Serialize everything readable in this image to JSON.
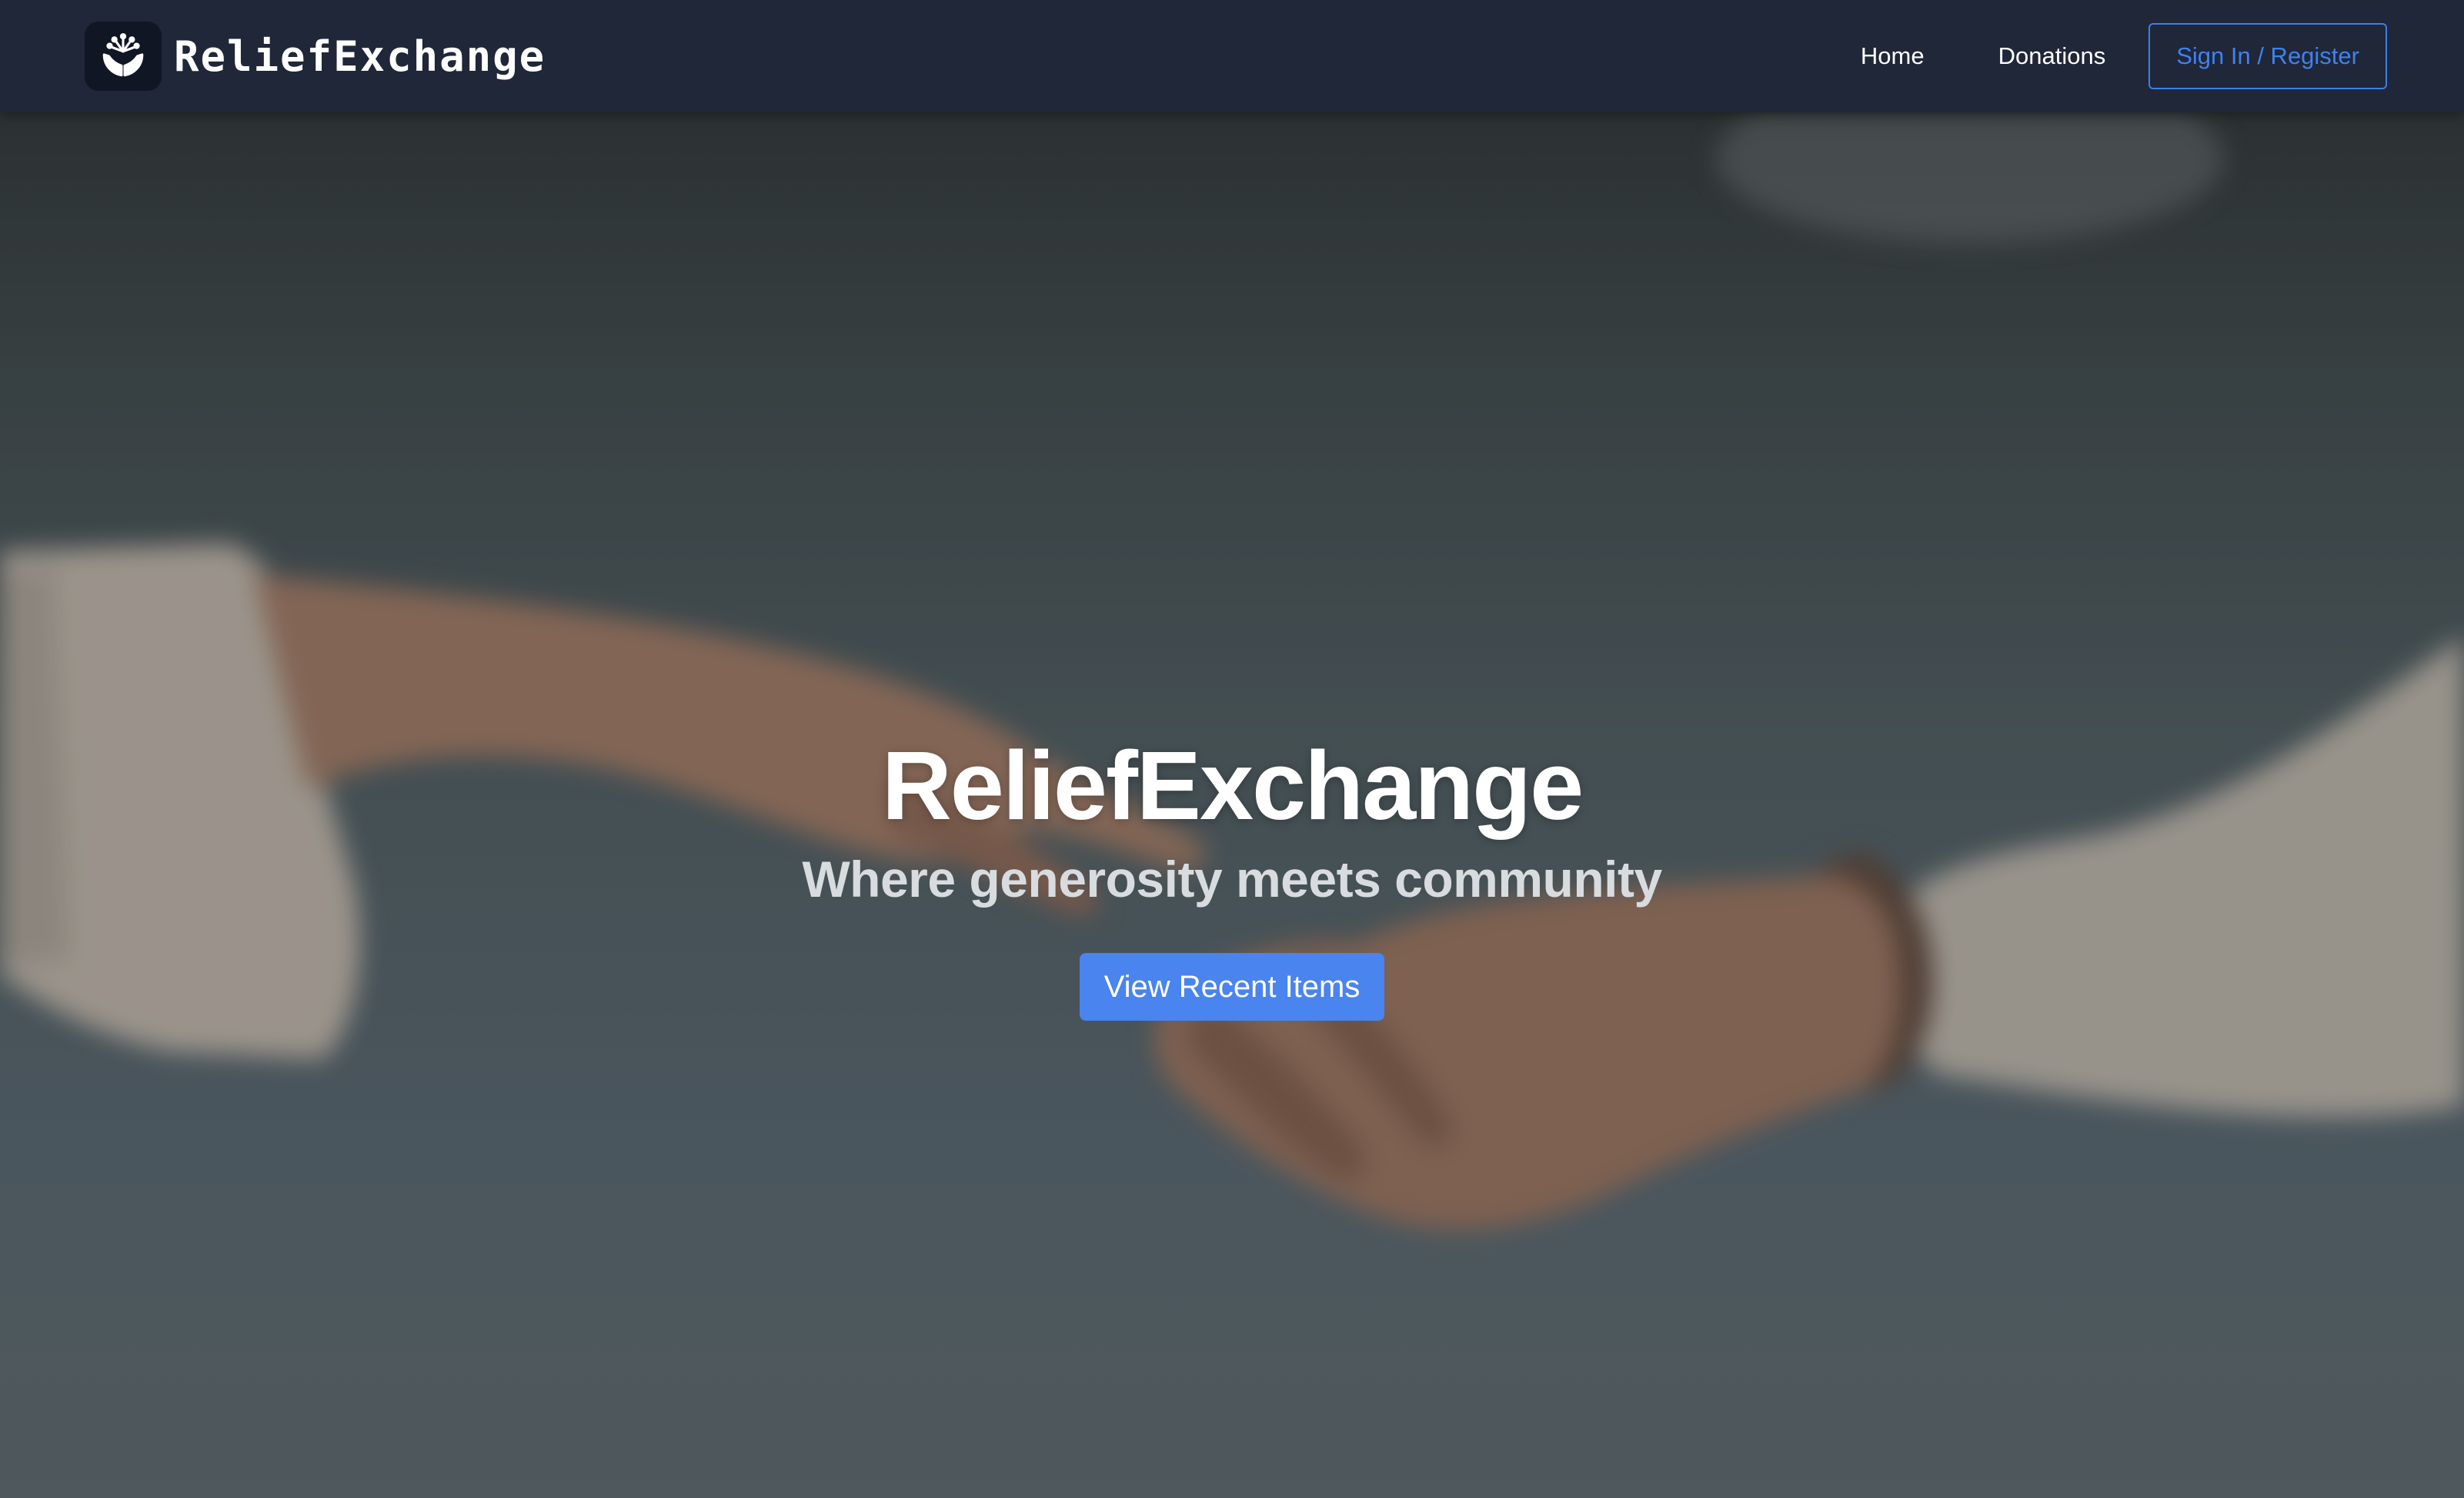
{
  "navbar": {
    "brand_name": "ReliefExchange",
    "logo_icon": "hands-with-sprout-icon",
    "links": [
      {
        "label": "Home"
      },
      {
        "label": "Donations"
      }
    ],
    "signin_label": "Sign In / Register"
  },
  "hero": {
    "title": "ReliefExchange",
    "subtitle": "Where generosity meets community",
    "cta_label": "View Recent Items",
    "background": "blurred-photo-of-two-reaching-hands"
  },
  "colors": {
    "navbar_bg": "#1f2738",
    "accent": "#4a84ee",
    "signin_border": "#3f7ee8"
  }
}
